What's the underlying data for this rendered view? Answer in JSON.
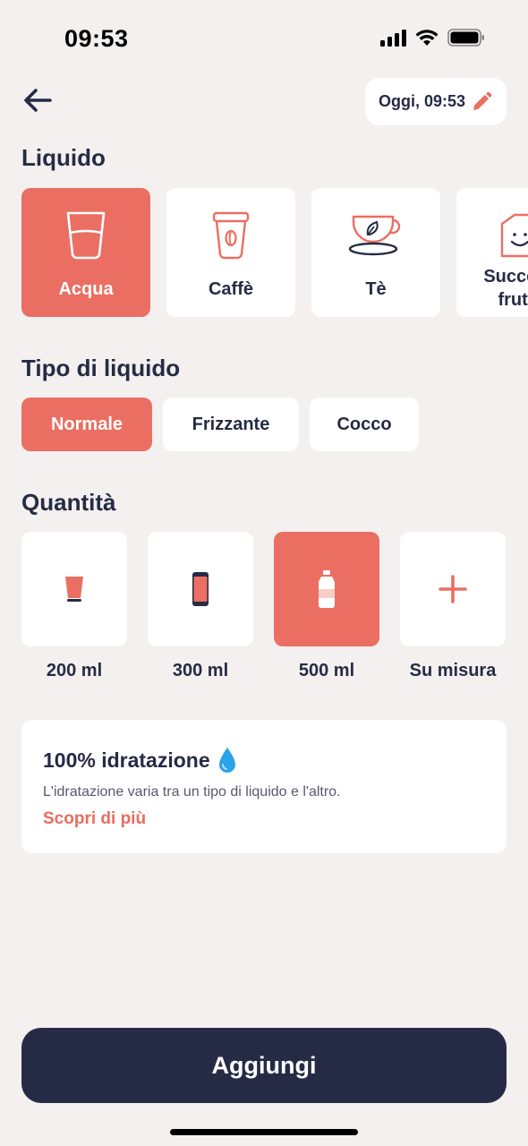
{
  "status_bar": {
    "time": "09:53"
  },
  "header": {
    "date_label": "Oggi, 09:53"
  },
  "liquid_section": {
    "title": "Liquido",
    "items": [
      {
        "label": "Acqua",
        "icon": "glass-icon",
        "selected": true
      },
      {
        "label": "Caffè",
        "icon": "coffee-cup-icon",
        "selected": false
      },
      {
        "label": "Tè",
        "icon": "tea-cup-icon",
        "selected": false
      },
      {
        "label": "Succo di frutta",
        "icon": "juice-box-icon",
        "selected": false
      }
    ]
  },
  "type_section": {
    "title": "Tipo di liquido",
    "options": [
      {
        "label": "Normale",
        "selected": true
      },
      {
        "label": "Frizzante",
        "selected": false
      },
      {
        "label": "Cocco",
        "selected": false
      }
    ]
  },
  "quantity_section": {
    "title": "Quantità",
    "options": [
      {
        "label": "200 ml",
        "icon": "small-cup-icon",
        "selected": false
      },
      {
        "label": "300 ml",
        "icon": "can-icon",
        "selected": false
      },
      {
        "label": "500 ml",
        "icon": "bottle-icon",
        "selected": true
      },
      {
        "label": "Su misura",
        "icon": "plus-icon",
        "selected": false
      }
    ]
  },
  "info_card": {
    "title": "100% idratazione",
    "description": "L'idratazione varia tra un tipo di liquido e l'altro.",
    "link": "Scopri di più"
  },
  "add_button": {
    "label": "Aggiungi"
  },
  "colors": {
    "accent": "#ea6f62",
    "navy": "#262b45",
    "background": "#f3f0ef",
    "drop": "#2aa4e8"
  }
}
